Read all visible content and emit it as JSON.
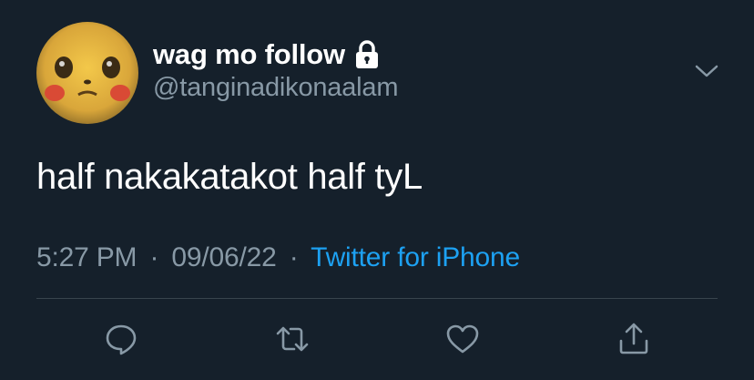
{
  "user": {
    "display_name": "wag mo follow",
    "handle": "@tanginadikonaalam",
    "avatar_icon": "avatar",
    "protected_icon": "lock-icon"
  },
  "tweet": {
    "text": "half nakakatakot half tyL",
    "time": "5:27 PM",
    "date": "09/06/22",
    "source": "Twitter for iPhone",
    "separator": "·"
  },
  "icons": {
    "more": "chevron-down-icon",
    "reply": "reply-icon",
    "retweet": "retweet-icon",
    "like": "heart-icon",
    "share": "share-icon"
  },
  "colors": {
    "background": "#15202b",
    "text": "#ffffff",
    "secondary": "#8899a6",
    "accent": "#1da1f2",
    "divider": "#38444d"
  }
}
